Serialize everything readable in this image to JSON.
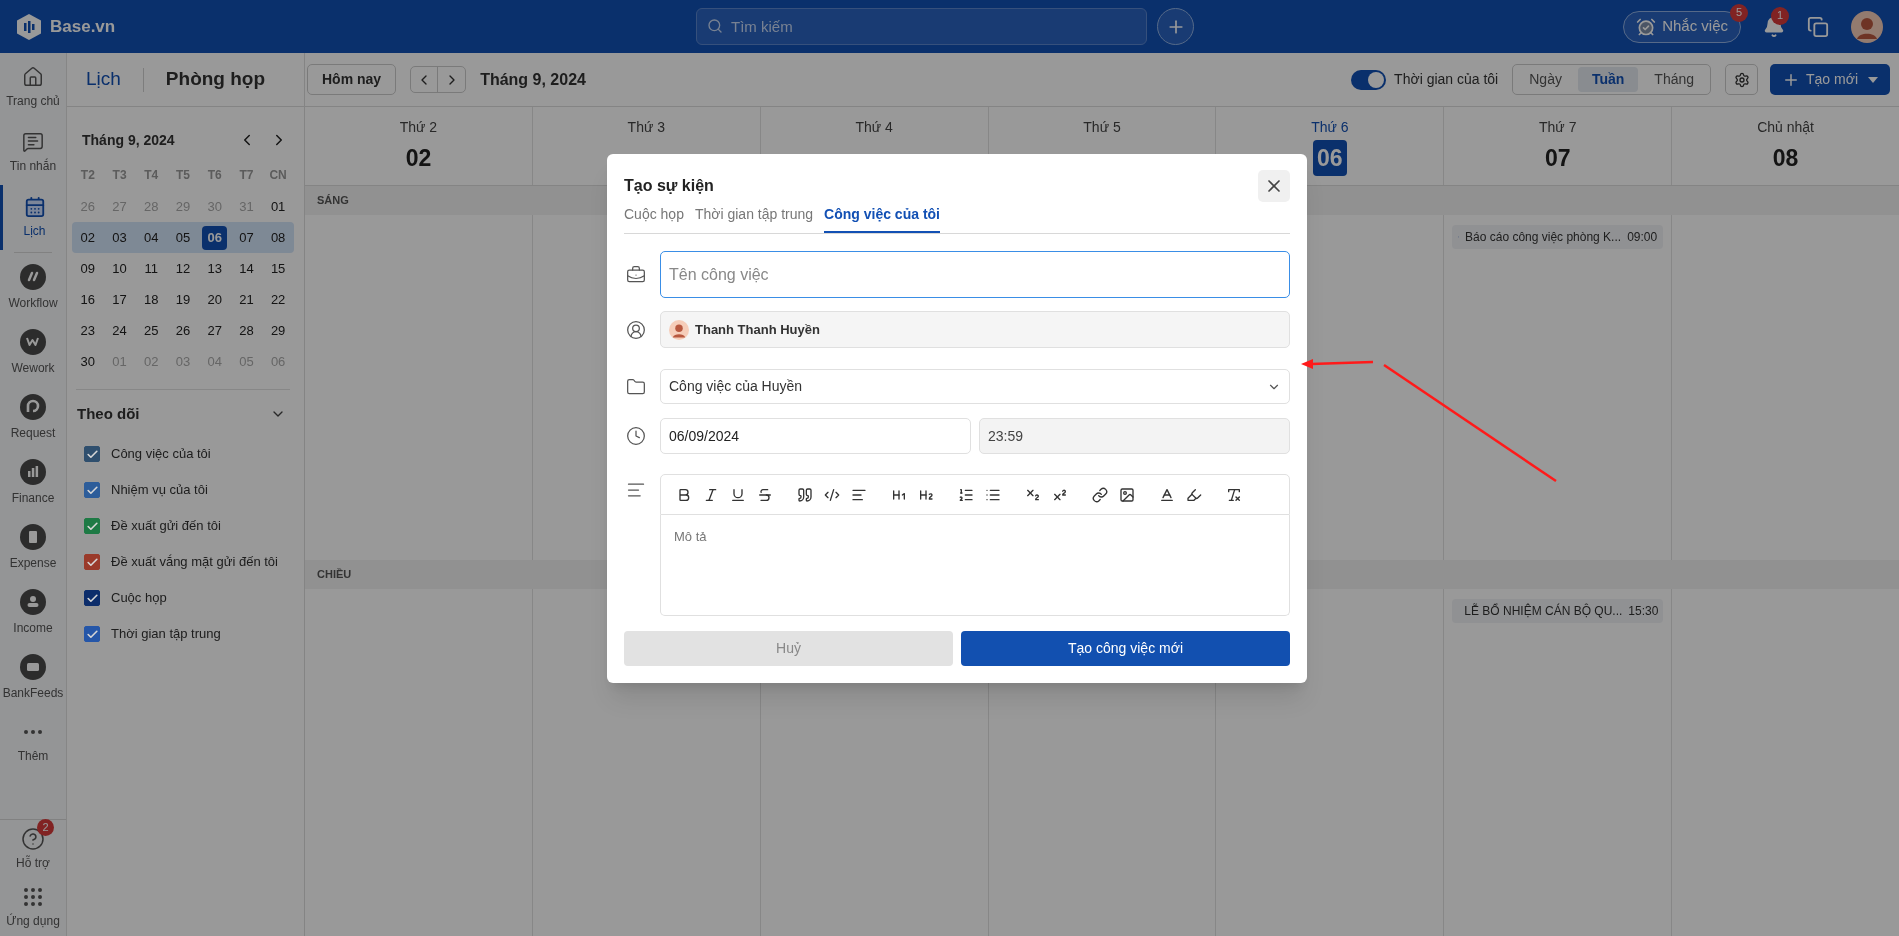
{
  "topbar": {
    "logo": "Base.vn",
    "search": {
      "placeholder": "Tìm kiếm"
    },
    "reminder": {
      "label": "Nhắc việc",
      "badge": "5"
    },
    "notifications": {
      "badge": "1"
    }
  },
  "rail": {
    "items": [
      {
        "label": "Trang chủ",
        "kind": "home",
        "selected": false
      },
      {
        "label": "Tin nhắn",
        "kind": "chat",
        "selected": false
      },
      {
        "label": "Lịch",
        "kind": "calendar",
        "selected": true
      },
      {
        "label": "Workflow",
        "kind": "workflow",
        "selected": false
      },
      {
        "label": "Wework",
        "kind": "wework",
        "selected": false
      },
      {
        "label": "Request",
        "kind": "request",
        "selected": false
      },
      {
        "label": "Finance",
        "kind": "finance",
        "selected": false
      },
      {
        "label": "Expense",
        "kind": "expense",
        "selected": false
      },
      {
        "label": "Income",
        "kind": "income",
        "selected": false
      },
      {
        "label": "BankFeeds",
        "kind": "bankfeeds",
        "selected": false
      },
      {
        "label": "Thêm",
        "kind": "more",
        "selected": false
      }
    ],
    "bottom": [
      {
        "label": "Hỗ trợ",
        "kind": "help",
        "badge": "2"
      },
      {
        "label": "Ứng dụng",
        "kind": "apps"
      }
    ]
  },
  "toolbar": {
    "tabs": [
      {
        "label": "Lịch",
        "selected": true
      },
      {
        "label": "Phòng họp",
        "selected": false
      }
    ],
    "today_button": "Hôm nay",
    "period": "Tháng 9, 2024",
    "my_time": {
      "label": "Thời gian của tôi",
      "on": true
    },
    "views": [
      {
        "label": "Ngày",
        "selected": false
      },
      {
        "label": "Tuần",
        "selected": true
      },
      {
        "label": "Tháng",
        "selected": false
      }
    ],
    "create_button": "Tạo mới"
  },
  "mini_calendar": {
    "title": "Tháng 9, 2024",
    "weekdays": [
      "T2",
      "T3",
      "T4",
      "T5",
      "T6",
      "T7",
      "CN"
    ],
    "weeks": [
      {
        "selected": false,
        "days": [
          {
            "label": "26",
            "outside": true,
            "today": false
          },
          {
            "label": "27",
            "outside": true,
            "today": false
          },
          {
            "label": "28",
            "outside": true,
            "today": false
          },
          {
            "label": "29",
            "outside": true,
            "today": false
          },
          {
            "label": "30",
            "outside": true,
            "today": false
          },
          {
            "label": "31",
            "outside": true,
            "today": false
          },
          {
            "label": "01",
            "outside": false,
            "today": false
          }
        ]
      },
      {
        "selected": true,
        "days": [
          {
            "label": "02",
            "outside": false,
            "today": false
          },
          {
            "label": "03",
            "outside": false,
            "today": false
          },
          {
            "label": "04",
            "outside": false,
            "today": false
          },
          {
            "label": "05",
            "outside": false,
            "today": false
          },
          {
            "label": "06",
            "outside": false,
            "today": true
          },
          {
            "label": "07",
            "outside": false,
            "today": false
          },
          {
            "label": "08",
            "outside": false,
            "today": false
          }
        ]
      },
      {
        "selected": false,
        "days": [
          {
            "label": "09",
            "outside": false,
            "today": false
          },
          {
            "label": "10",
            "outside": false,
            "today": false
          },
          {
            "label": "11",
            "outside": false,
            "today": false
          },
          {
            "label": "12",
            "outside": false,
            "today": false
          },
          {
            "label": "13",
            "outside": false,
            "today": false
          },
          {
            "label": "14",
            "outside": false,
            "today": false
          },
          {
            "label": "15",
            "outside": false,
            "today": false
          }
        ]
      },
      {
        "selected": false,
        "days": [
          {
            "label": "16",
            "outside": false,
            "today": false
          },
          {
            "label": "17",
            "outside": false,
            "today": false
          },
          {
            "label": "18",
            "outside": false,
            "today": false
          },
          {
            "label": "19",
            "outside": false,
            "today": false
          },
          {
            "label": "20",
            "outside": false,
            "today": false
          },
          {
            "label": "21",
            "outside": false,
            "today": false
          },
          {
            "label": "22",
            "outside": false,
            "today": false
          }
        ]
      },
      {
        "selected": false,
        "days": [
          {
            "label": "23",
            "outside": false,
            "today": false
          },
          {
            "label": "24",
            "outside": false,
            "today": false
          },
          {
            "label": "25",
            "outside": false,
            "today": false
          },
          {
            "label": "26",
            "outside": false,
            "today": false
          },
          {
            "label": "27",
            "outside": false,
            "today": false
          },
          {
            "label": "28",
            "outside": false,
            "today": false
          },
          {
            "label": "29",
            "outside": false,
            "today": false
          }
        ]
      },
      {
        "selected": false,
        "days": [
          {
            "label": "30",
            "outside": false,
            "today": false
          },
          {
            "label": "01",
            "outside": true,
            "today": false
          },
          {
            "label": "02",
            "outside": true,
            "today": false
          },
          {
            "label": "03",
            "outside": true,
            "today": false
          },
          {
            "label": "04",
            "outside": true,
            "today": false
          },
          {
            "label": "05",
            "outside": true,
            "today": false
          },
          {
            "label": "06",
            "outside": true,
            "today": false
          }
        ]
      }
    ]
  },
  "follow": {
    "title": "Theo dõi",
    "expanded": true,
    "items": [
      {
        "label": "Công việc của tôi",
        "checked": true,
        "color": "#2f4f6e"
      },
      {
        "label": "Nhiệm vụ của tôi",
        "checked": true,
        "color": "#2d5d9a"
      },
      {
        "label": "Đề xuất gửi đến tôi",
        "checked": true,
        "color": "#1e7a45"
      },
      {
        "label": "Đề xuất vắng mặt gửi đến tôi",
        "checked": true,
        "color": "#9a3a2a"
      },
      {
        "label": "Cuộc họp",
        "checked": true,
        "color": "#0c2d6b"
      },
      {
        "label": "Thời gian tập trung",
        "checked": true,
        "color": "#2556a8"
      }
    ]
  },
  "week": {
    "morning_label": "SÁNG",
    "afternoon_label": "CHIỀU",
    "days": [
      {
        "weekday": "Thứ 2",
        "date": "02",
        "today": false
      },
      {
        "weekday": "Thứ 3",
        "today": false
      },
      {
        "weekday": "Thứ 4",
        "today": false
      },
      {
        "weekday": "Thứ 5",
        "today": false
      },
      {
        "weekday": "Thứ 6",
        "date": "06",
        "today": true
      },
      {
        "weekday": "Thứ 7",
        "date": "07",
        "today": false,
        "morning": [
          {
            "title": "Báo cáo công việc phòng K...",
            "time": "09:00"
          }
        ],
        "afternoon": [
          {
            "title": "LỄ BỔ NHIỆM CÁN BỘ QU...",
            "time": "15:30"
          }
        ]
      },
      {
        "weekday": "Chủ nhật",
        "date": "08",
        "today": false
      }
    ]
  },
  "modal": {
    "title": "Tạo sự kiện",
    "tabs": [
      {
        "label": "Cuộc họp",
        "selected": false
      },
      {
        "label": "Thời gian tập trung",
        "selected": false
      },
      {
        "label": "Công việc của tôi",
        "selected": true
      }
    ],
    "name": {
      "placeholder": "Tên công việc",
      "focused": true
    },
    "assignee": {
      "name": "Thanh Thanh Huyền"
    },
    "project": {
      "value": "Công việc của Huyền"
    },
    "date": {
      "value": "06/09/2024"
    },
    "time": {
      "value": "23:59",
      "disabled": true
    },
    "description": {
      "placeholder": "Mô tả"
    },
    "cancel_button": "Huỷ",
    "submit_button": "Tạo công việc mới"
  }
}
